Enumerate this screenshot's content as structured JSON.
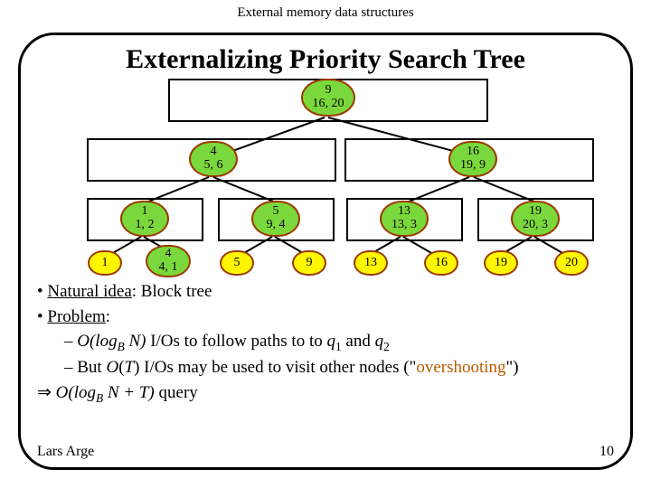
{
  "page_header": "External memory data structures",
  "title": "Externalizing Priority Search Tree",
  "tree": {
    "root": {
      "k": "9",
      "pt": "16, 20"
    },
    "l2": [
      {
        "k": "4",
        "pt": "5, 6"
      },
      {
        "k": "16",
        "pt": "19, 9"
      }
    ],
    "l3": [
      {
        "k": "1",
        "pt": "1, 2"
      },
      {
        "k": "5",
        "pt": "9, 4"
      },
      {
        "k": "13",
        "pt": "13, 3"
      },
      {
        "k": "19",
        "pt": "20, 3"
      }
    ],
    "leaves": [
      "1",
      "4",
      "5",
      "9",
      "13",
      "16",
      "19",
      "20"
    ],
    "leaf_pt": "4, 1"
  },
  "body": {
    "b1": "Natural idea",
    "b1b": ": Block tree",
    "b2": "Problem",
    "b2a": "I/Os to follow paths to to ",
    "q1": "q",
    "q1s": "1",
    "and": " and ",
    "q2": "q",
    "q2s": "2",
    "b2b_a": "But ",
    "b2b_o": "O",
    "b2b_t": "(",
    "b2b_T": "T",
    "b2b_cl": ") I/Os may be used to visit other nodes (\"",
    "over": "overshooting",
    "b2b_end": "\")",
    "b3": " query",
    "logBN": "O(log",
    "logB": "B",
    "logN": " N)",
    "logBNT": "O(log",
    "logBNT_b": "B",
    "logBNT_r": " N + T)"
  },
  "footer": {
    "left": "Lars Arge",
    "right": "10"
  }
}
